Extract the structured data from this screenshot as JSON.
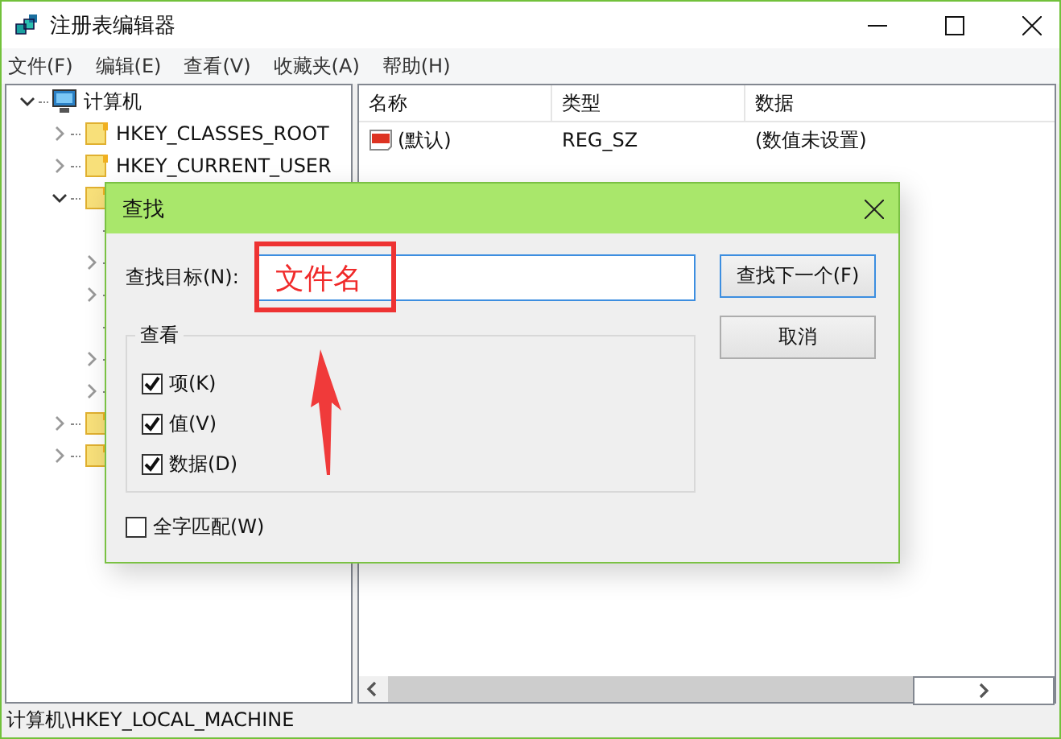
{
  "window": {
    "title": "注册表编辑器"
  },
  "menu": [
    "文件(F)",
    "编辑(E)",
    "查看(V)",
    "收藏夹(A)",
    "帮助(H)"
  ],
  "tree": {
    "label": "计算机",
    "expanded": true,
    "children": [
      {
        "label": "HKEY_CLASSES_ROOT",
        "has_children": true,
        "expanded": false
      },
      {
        "label": "HKEY_CURRENT_USER",
        "has_children": true,
        "expanded": false
      },
      {
        "has_children": true,
        "expanded": true,
        "children": [
          {
            "has_children": false
          },
          {
            "has_children": true,
            "expanded": false
          },
          {
            "has_children": true,
            "expanded": false
          },
          {
            "has_children": false
          },
          {
            "has_children": true,
            "expanded": false
          },
          {
            "has_children": true,
            "expanded": false
          }
        ]
      },
      {
        "has_children": true,
        "expanded": false
      },
      {
        "has_children": true,
        "expanded": false
      }
    ]
  },
  "table": {
    "columns": [
      "名称",
      "类型",
      "数据"
    ],
    "rows": [
      {
        "name": "(默认)",
        "type": "REG_SZ",
        "data": "(数值未设置)"
      }
    ]
  },
  "dialog": {
    "title": "查找",
    "target_label": "查找目标(N):",
    "value": "文件名",
    "buttons": [
      {
        "label": "查找下一个(F)",
        "default": true
      },
      {
        "label": "取消",
        "default": false
      }
    ],
    "group": {
      "title": "查看",
      "options": [
        {
          "label": "项(K)",
          "checked": true
        },
        {
          "label": "值(V)",
          "checked": true
        },
        {
          "label": "数据(D)",
          "checked": true
        }
      ]
    },
    "whole_word": {
      "label": "全字匹配(W)",
      "checked": false
    }
  },
  "status_bar": "计算机\\HKEY_LOCAL_MACHINE"
}
